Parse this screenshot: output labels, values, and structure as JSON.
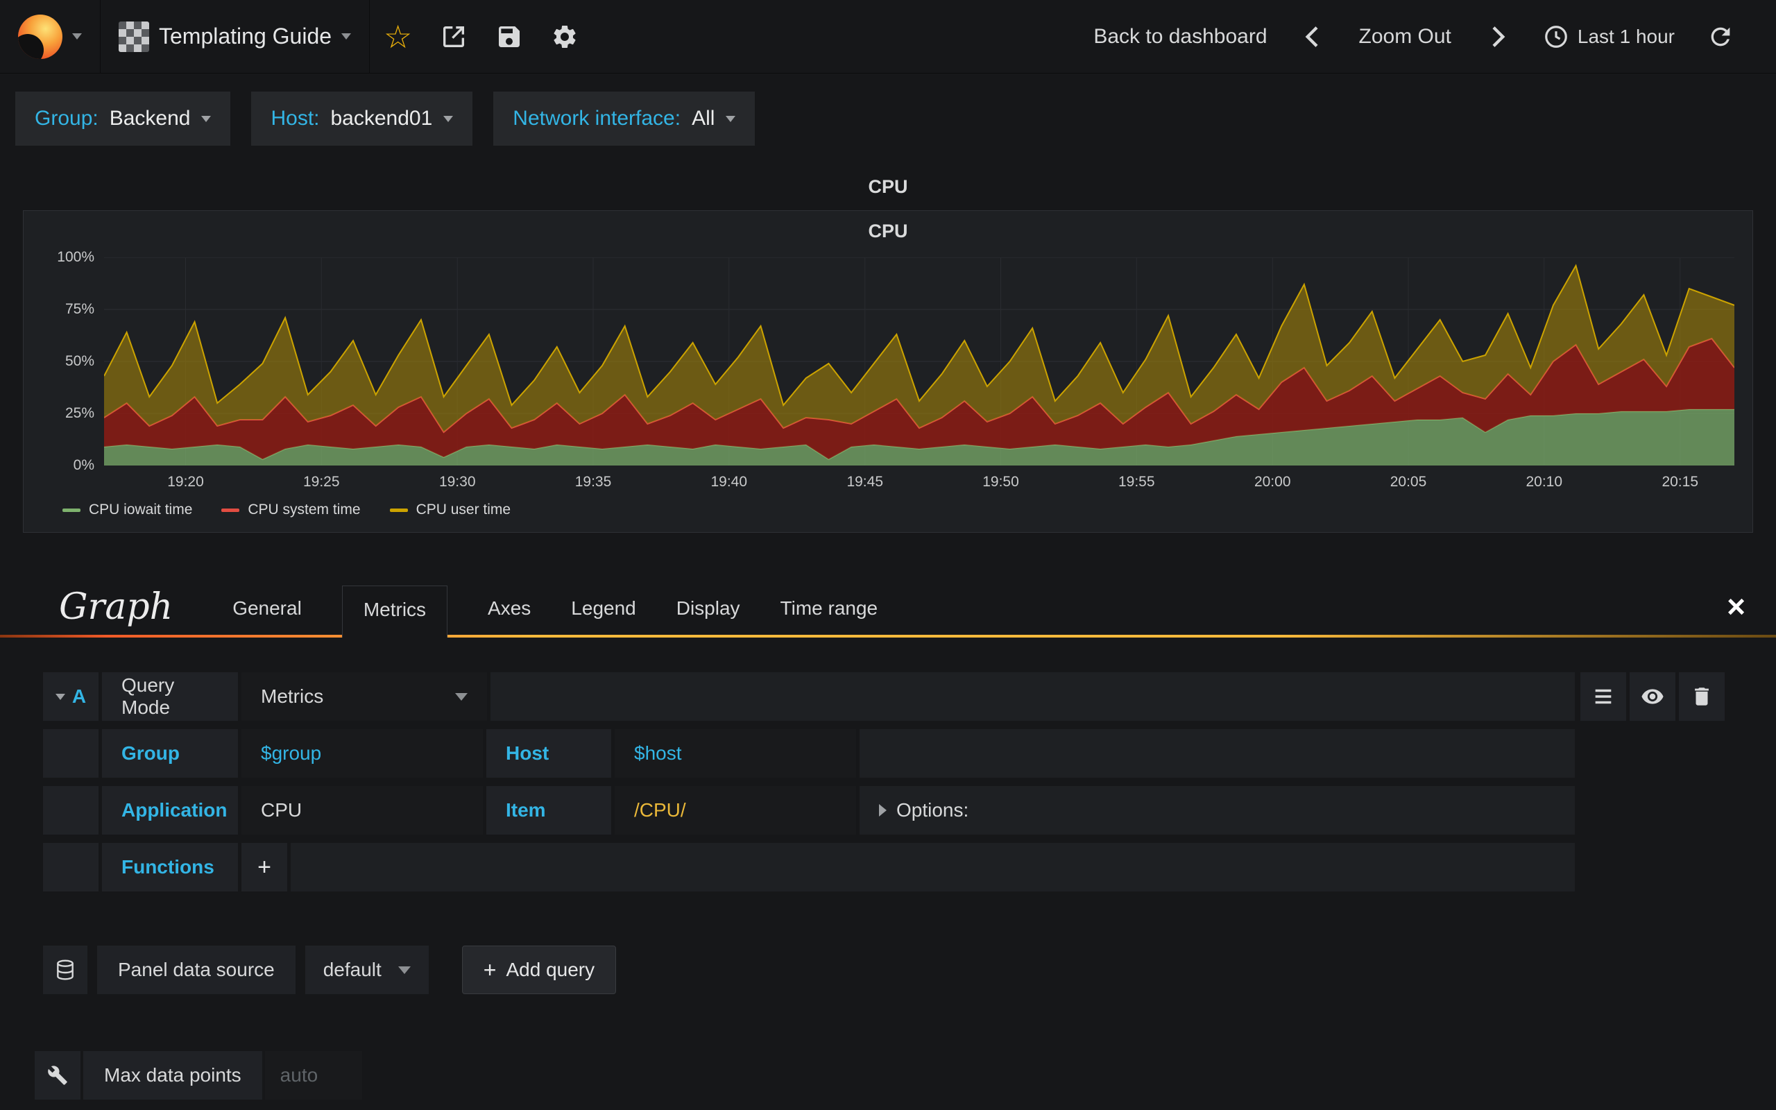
{
  "navbar": {
    "dashboard_title": "Templating Guide",
    "back_to_dashboard": "Back to dashboard",
    "zoom_out": "Zoom Out",
    "time_range": "Last 1 hour"
  },
  "variables": [
    {
      "label": "Group:",
      "value": "Backend"
    },
    {
      "label": "Host:",
      "value": "backend01"
    },
    {
      "label": "Network interface:",
      "value": "All"
    }
  ],
  "panel": {
    "row_title": "CPU",
    "title": "CPU"
  },
  "chart_data": {
    "type": "area",
    "stacked": true,
    "title": "CPU",
    "ylim": [
      0,
      100
    ],
    "y_ticks": [
      "0%",
      "25%",
      "50%",
      "75%",
      "100%"
    ],
    "x_ticks": [
      "19:20",
      "19:25",
      "19:30",
      "19:35",
      "19:40",
      "19:45",
      "19:50",
      "19:55",
      "20:00",
      "20:05",
      "20:10",
      "20:15"
    ],
    "x_tick_fractions": [
      0.05,
      0.1333,
      0.2167,
      0.3,
      0.3833,
      0.4667,
      0.55,
      0.6333,
      0.7167,
      0.8,
      0.8833,
      0.9667
    ],
    "time_start": "19:17",
    "time_end": "20:17",
    "legend_position": "bottom",
    "grid": true,
    "series": [
      {
        "name": "CPU iowait time",
        "color": "#7eb26d",
        "fill": "rgba(126,178,109,0.72)",
        "values": [
          9,
          10,
          9,
          8,
          9,
          10,
          9,
          3,
          8,
          10,
          9,
          8,
          9,
          10,
          9,
          4,
          9,
          10,
          9,
          8,
          10,
          9,
          8,
          9,
          10,
          9,
          8,
          10,
          9,
          8,
          9,
          10,
          3,
          9,
          10,
          9,
          8,
          9,
          10,
          9,
          8,
          9,
          10,
          9,
          8,
          9,
          10,
          9,
          10,
          12,
          14,
          15,
          16,
          17,
          18,
          19,
          20,
          21,
          22,
          22,
          23,
          16,
          22,
          24,
          24,
          25,
          25,
          26,
          26,
          26,
          27,
          27,
          27
        ]
      },
      {
        "name": "CPU system time",
        "color": "#e24d42",
        "fill": "rgba(140,28,20,0.85)",
        "values": [
          14,
          20,
          10,
          16,
          24,
          9,
          13,
          19,
          25,
          11,
          15,
          21,
          10,
          18,
          24,
          12,
          16,
          22,
          9,
          14,
          20,
          11,
          17,
          25,
          10,
          15,
          22,
          12,
          18,
          24,
          9,
          13,
          19,
          11,
          16,
          23,
          10,
          14,
          21,
          12,
          17,
          24,
          10,
          15,
          22,
          11,
          18,
          26,
          10,
          14,
          20,
          12,
          24,
          30,
          13,
          17,
          23,
          10,
          15,
          21,
          12,
          16,
          22,
          10,
          26,
          33,
          14,
          19,
          25,
          12,
          30,
          34,
          20
        ]
      },
      {
        "name": "CPU user time",
        "color": "#cca300",
        "fill": "rgba(160,130,10,0.6)",
        "values": [
          20,
          34,
          14,
          24,
          36,
          11,
          17,
          27,
          38,
          13,
          21,
          31,
          15,
          25,
          37,
          17,
          23,
          31,
          11,
          19,
          27,
          15,
          23,
          33,
          13,
          21,
          29,
          17,
          25,
          35,
          11,
          19,
          27,
          15,
          23,
          31,
          13,
          21,
          29,
          17,
          25,
          33,
          11,
          19,
          29,
          15,
          23,
          37,
          13,
          21,
          29,
          15,
          27,
          40,
          17,
          23,
          31,
          11,
          19,
          27,
          15,
          21,
          29,
          13,
          27,
          38,
          17,
          23,
          31,
          15,
          28,
          20,
          30
        ]
      }
    ]
  },
  "editor": {
    "title": "Graph",
    "tabs": [
      "General",
      "Metrics",
      "Axes",
      "Legend",
      "Display",
      "Time range"
    ],
    "active_tab": "Metrics",
    "query": {
      "ref": "A",
      "query_mode_label": "Query Mode",
      "query_mode_value": "Metrics",
      "group_label": "Group",
      "group_value": "$group",
      "host_label": "Host",
      "host_value": "$host",
      "application_label": "Application",
      "application_value": "CPU",
      "item_label": "Item",
      "item_value": "/CPU/",
      "options_label": "Options:",
      "functions_label": "Functions",
      "add_function_label": "+"
    },
    "datasource": {
      "label": "Panel data source",
      "value": "default",
      "add_query": "Add query"
    },
    "max_data_points": {
      "label": "Max data points",
      "placeholder": "auto"
    }
  },
  "colors": {
    "accent_blue": "#33b5e5",
    "item_yellow": "#eab839",
    "grafana_orange": "#f05a28"
  }
}
